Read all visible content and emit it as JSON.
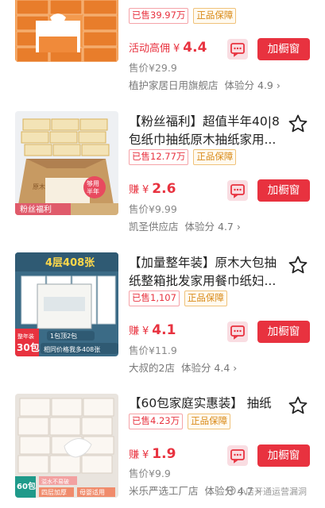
{
  "items": [
    {
      "title": "",
      "sold": "已售39.97万",
      "guarantee": "正品保障",
      "price_label": "活动高佣",
      "price_currency": "¥",
      "price_int": "4.",
      "price_dec": "4",
      "original_price": "售价¥29.9",
      "shop": "植护家居日用旗舰店",
      "score": "体验分 4.9",
      "buy_label": "加橱窗"
    },
    {
      "title": "【粉丝福利】超值半年40|8包纸巾抽纸原木抽纸家用...",
      "sold": "已售12.77万",
      "guarantee": "正品保障",
      "price_label": "赚",
      "price_currency": "¥",
      "price_int": "2.",
      "price_dec": "6",
      "original_price": "售价¥9.99",
      "shop": "凯圣供应店",
      "score": "体验分 4.7",
      "buy_label": "加橱窗",
      "thumb_text": [
        "原木臻品",
        "粉丝福利",
        "够用半年"
      ]
    },
    {
      "title": "【加量整年装】原木大包抽纸整箱批发家用餐巾纸妇...",
      "sold": "已售1,107",
      "guarantee": "正品保障",
      "price_label": "赚",
      "price_currency": "¥",
      "price_int": "4.",
      "price_dec": "1",
      "original_price": "售价¥11.9",
      "shop": "大叔的2店",
      "score": "体验分 4.4",
      "buy_label": "加橱窗",
      "thumb_text": [
        "4层408张",
        "整年装",
        "30包",
        "1包顶2包",
        "相同价格我多408张"
      ]
    },
    {
      "title": "【60包家庭实惠装】 抽纸",
      "sold": "已售4.23万",
      "guarantee": "正品保障",
      "price_label": "赚",
      "price_currency": "¥",
      "price_int": "1.",
      "price_dec": "9",
      "original_price": "售价¥9.9",
      "shop": "米乐严选工厂店",
      "score": "体验分 4.7",
      "buy_label": "加橱窗",
      "thumb_text": [
        "60包",
        "溢水不易破",
        "四层加厚",
        "母婴适用"
      ]
    }
  ],
  "watermark": "小店开通运营漏洞",
  "colors": {
    "accent": "#e8323f",
    "guarantee": "#d98a18",
    "muted": "#888888"
  },
  "icons": {
    "favorite": "star-outline-icon",
    "message": "chat-bubble-icon",
    "chevron": "chevron-right-icon"
  }
}
